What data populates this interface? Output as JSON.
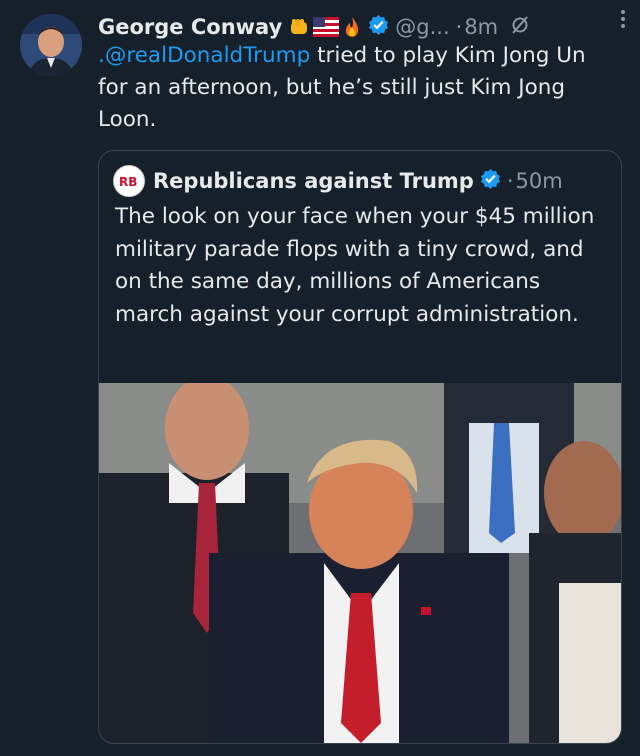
{
  "tweet": {
    "author_name": "George Conway",
    "handle": "@g...",
    "dot": "·",
    "time": "8m",
    "text_mention": ".@realDonaldTrump",
    "text_rest": " tried to play Kim Jong Un for an afternoon, but he’s still just Kim Jong Loon."
  },
  "quote": {
    "author_name": "Republicans against Trump",
    "avatar_text": "RB",
    "dot": "·",
    "time": "50m",
    "text": "The look on your face when your $45 million military parade flops with a tiny crowd, and on the same day, millions of Americans march against your corrupt administration."
  },
  "icons": {
    "verified": "verified-badge-icon",
    "grok": "grok-icon",
    "more": "more-icon",
    "emojis": [
      "fist-emoji",
      "us-flag-emoji",
      "fire-emoji"
    ]
  },
  "colors": {
    "background": "#15202b",
    "link": "#1d9bf0",
    "secondary_text": "#8b98a5",
    "primary_text": "#e7e9ea"
  }
}
